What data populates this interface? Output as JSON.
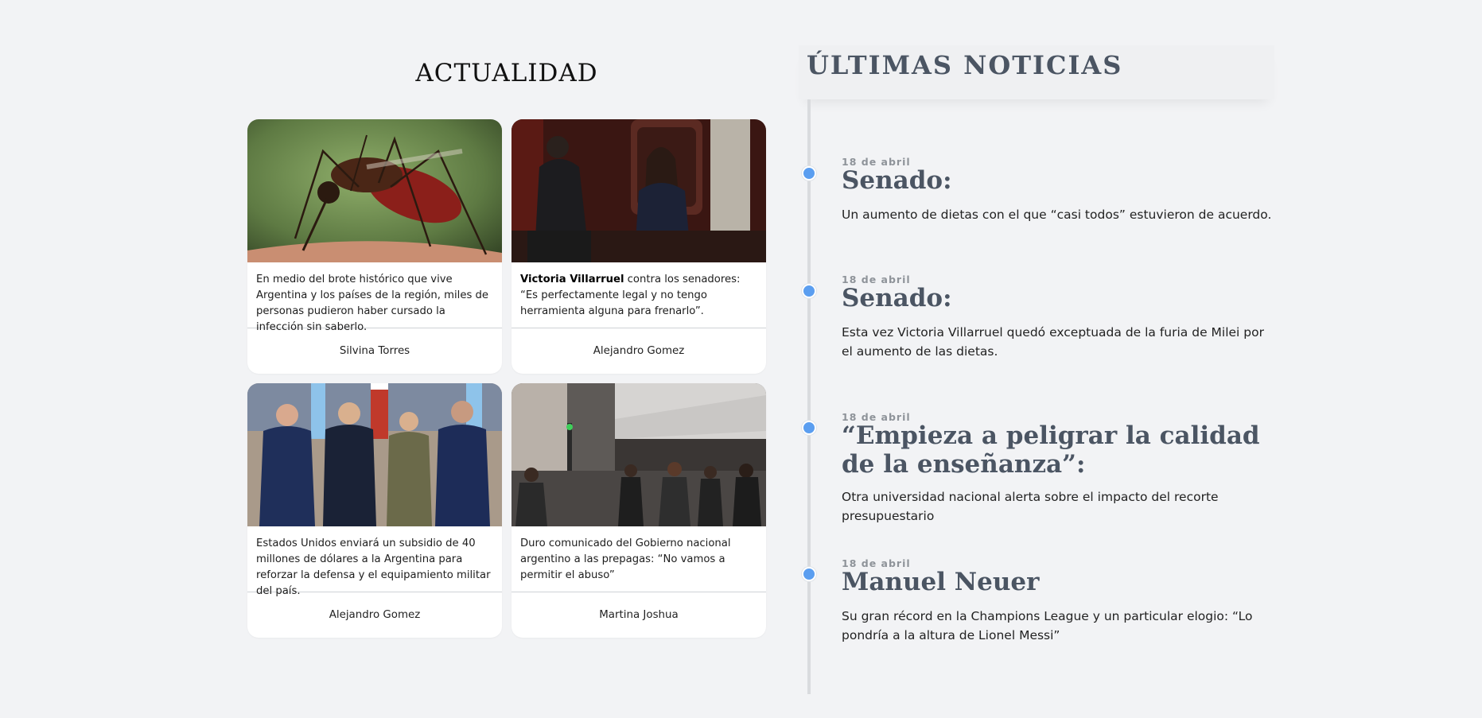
{
  "actualidad": {
    "title": "ACTUALIDAD",
    "cards": [
      {
        "image": "mosquito-photo",
        "text": "En medio del brote histórico que vive Argentina y los países de la región, miles de personas pudieron haber cursado la infección sin saberlo.",
        "author": "Silvina Torres"
      },
      {
        "image": "senate-president-photo",
        "text_bold": "Victoria Villarruel",
        "text": " contra los senadores: “Es perfectamente legal y no tengo herramienta alguna para frenarlo”.",
        "author": "Alejandro Gomez"
      },
      {
        "image": "officials-group-photo",
        "text": "Estados Unidos enviará un subsidio de 40 millones de dólares a la Argentina para reforzar la defensa y el equipamiento militar del país.",
        "author": "Alejandro Gomez"
      },
      {
        "image": "street-crowd-photo",
        "text": "Duro comunicado del Gobierno nacional argentino a las prepagas: “No vamos a permitir el abuso”",
        "author": "Martina Joshua"
      }
    ]
  },
  "ultimas": {
    "title": "ÚLTIMAS NOTICIAS",
    "accent_color": "#5b9ef0",
    "items": [
      {
        "date": "18 de abril",
        "title": "Senado:",
        "description": "Un aumento de dietas con el que “casi todos” estuvieron de acuerdo."
      },
      {
        "date": "18 de abril",
        "title": "Senado:",
        "description": "Esta vez Victoria Villarruel quedó exceptuada de la furia de Milei por el aumento de las dietas."
      },
      {
        "date": "18 de abril",
        "title": "“Empieza a peligrar la calidad de la enseñanza”:",
        "description": "Otra universidad nacional alerta sobre el impacto del recorte presupuestario"
      },
      {
        "date": "18 de abril",
        "title": "Manuel Neuer",
        "description": "Su gran récord en la Champions League y un particular elogio: “Lo pondría a la altura de Lionel Messi”"
      }
    ]
  }
}
